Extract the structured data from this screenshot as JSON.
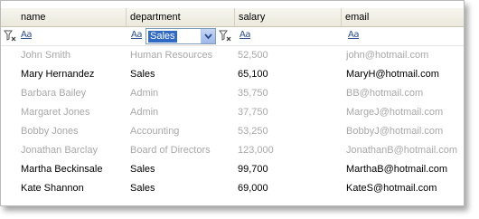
{
  "columns": [
    "name",
    "department",
    "salary",
    "email"
  ],
  "filter": {
    "aa_glyph": "Aa",
    "department_value": "Sales"
  },
  "rows": [
    {
      "name": "John Smith",
      "department": "Human Resources",
      "salary": "52,500",
      "email": "john@hotmail.com",
      "match": false
    },
    {
      "name": "Mary Hernandez",
      "department": "Sales",
      "salary": "65,100",
      "email": "MaryH@hotmail.com",
      "match": true
    },
    {
      "name": "Barbara Bailey",
      "department": "Admin",
      "salary": "35,750",
      "email": "BB@hotmail.com",
      "match": false
    },
    {
      "name": "Margaret Jones",
      "department": "Admin",
      "salary": "37,750",
      "email": "MargeJ@hotmail.com",
      "match": false
    },
    {
      "name": "Bobby Jones",
      "department": "Accounting",
      "salary": "53,250",
      "email": "BobbyJ@hotmail.com",
      "match": false
    },
    {
      "name": "Jonathan Barclay",
      "department": "Board of Directors",
      "salary": "123,000",
      "email": "JonathanB@hotmail.com",
      "match": false
    },
    {
      "name": "Martha Beckinsale",
      "department": "Sales",
      "salary": "99,700",
      "email": "MarthaB@hotmail.com",
      "match": true
    },
    {
      "name": "Kate Shannon",
      "department": "Sales",
      "salary": "69,000",
      "email": "KateS@hotmail.com",
      "match": true
    }
  ],
  "colors": {
    "matched_text": "#000000",
    "filtered_out_text": "#a8a8a8",
    "selection": "#316ac5"
  }
}
